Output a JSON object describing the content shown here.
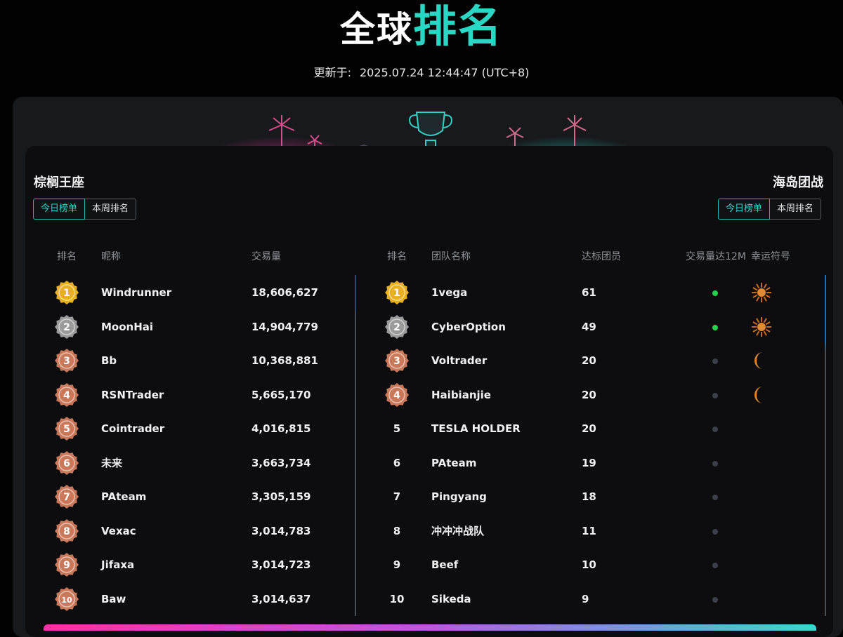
{
  "header": {
    "title_white": "全球",
    "title_accent": "排名",
    "updated_label": "更新于:",
    "updated_value": "2025.07.24 12:44:47 (UTC+8)"
  },
  "colors": {
    "accent": "#2ad6c4",
    "pink": "#ff2fa8",
    "green_dot": "#22d24a",
    "gray_dot": "#3b3f49",
    "gold": "#e8b020",
    "silver": "#9a9a9a",
    "bronze": "#c9785a"
  },
  "left": {
    "title": "棕榈王座",
    "tabs": [
      "今日榜单",
      "本周排名"
    ],
    "active_tab": 0,
    "columns": [
      "排名",
      "昵称",
      "交易量"
    ],
    "rows": [
      {
        "rank": "1",
        "medal": "gold",
        "name": "Windrunner",
        "volume": "18,606,627"
      },
      {
        "rank": "2",
        "medal": "silver",
        "name": "MoonHai",
        "volume": "14,904,779"
      },
      {
        "rank": "3",
        "medal": "bronze",
        "name": "Bb",
        "volume": "10,368,881"
      },
      {
        "rank": "4",
        "medal": "bronze",
        "name": "RSNTrader",
        "volume": "5,665,170"
      },
      {
        "rank": "5",
        "medal": "bronze",
        "name": "Cointrader",
        "volume": "4,016,815"
      },
      {
        "rank": "6",
        "medal": "bronze",
        "name": "未来",
        "volume": "3,663,734"
      },
      {
        "rank": "7",
        "medal": "bronze",
        "name": "PAteam",
        "volume": "3,305,159"
      },
      {
        "rank": "8",
        "medal": "bronze",
        "name": "Vexac",
        "volume": "3,014,783"
      },
      {
        "rank": "9",
        "medal": "bronze",
        "name": "Jifaxa",
        "volume": "3,014,723"
      },
      {
        "rank": "10",
        "medal": "bronze",
        "name": "Baw",
        "volume": "3,014,637"
      }
    ]
  },
  "right": {
    "title": "海岛团战",
    "tabs": [
      "今日榜单",
      "本周排名"
    ],
    "active_tab": 0,
    "columns": [
      "排名",
      "团队名称",
      "达标团员",
      "交易量达12M",
      "幸运符号"
    ],
    "rows": [
      {
        "rank": "1",
        "medal": "gold",
        "team": "1vega",
        "members": "61",
        "reached": true,
        "symbol": "sun-icon"
      },
      {
        "rank": "2",
        "medal": "silver",
        "team": "CyberOption",
        "members": "49",
        "reached": true,
        "symbol": "sun-icon"
      },
      {
        "rank": "3",
        "medal": "bronze",
        "team": "Voltrader",
        "members": "20",
        "reached": false,
        "symbol": "moon-icon"
      },
      {
        "rank": "4",
        "medal": "bronze",
        "team": "Haibianjie",
        "members": "20",
        "reached": false,
        "symbol": "moon-icon"
      },
      {
        "rank": "5",
        "medal": "",
        "team": "TESLA HOLDER",
        "members": "20",
        "reached": false,
        "symbol": ""
      },
      {
        "rank": "6",
        "medal": "",
        "team": "PAteam",
        "members": "19",
        "reached": false,
        "symbol": ""
      },
      {
        "rank": "7",
        "medal": "",
        "team": "Pingyang",
        "members": "18",
        "reached": false,
        "symbol": ""
      },
      {
        "rank": "8",
        "medal": "",
        "team": "冲冲冲战队",
        "members": "11",
        "reached": false,
        "symbol": ""
      },
      {
        "rank": "9",
        "medal": "",
        "team": "Beef",
        "members": "10",
        "reached": false,
        "symbol": ""
      },
      {
        "rank": "10",
        "medal": "",
        "team": "Sikeda",
        "members": "9",
        "reached": false,
        "symbol": ""
      }
    ]
  }
}
